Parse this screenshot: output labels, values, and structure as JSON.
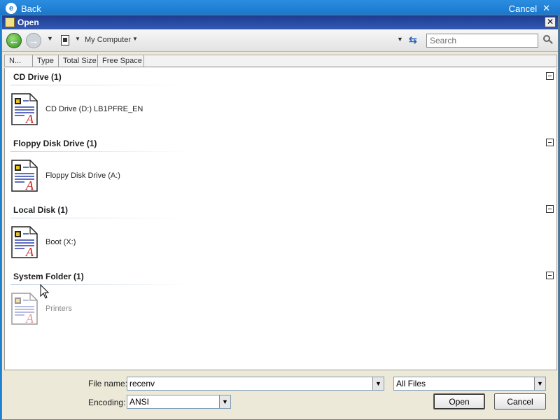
{
  "background": {
    "back_label": "Back",
    "cancel_label": "Cancel"
  },
  "dialog": {
    "title": "Open",
    "close_symbol": "✕"
  },
  "toolbar": {
    "location": "My Computer",
    "search_placeholder": "Search"
  },
  "columns": [
    "N...",
    "Type",
    "Total Size",
    "Free Space"
  ],
  "groups": [
    {
      "header": "CD Drive (1)",
      "item": "CD Drive (D:) LB1PFRE_EN",
      "dim": false
    },
    {
      "header": "Floppy Disk Drive (1)",
      "item": "Floppy Disk Drive (A:)",
      "dim": false
    },
    {
      "header": "Local Disk (1)",
      "item": "Boot (X:)",
      "dim": false
    },
    {
      "header": "System Folder (1)",
      "item": "Printers",
      "dim": true
    }
  ],
  "bottom": {
    "file_name_label": "File name:",
    "file_name_value": "recenv",
    "file_type_value": "All Files",
    "encoding_label": "Encoding:",
    "encoding_value": "ANSI",
    "open_label": "Open",
    "cancel_label": "Cancel"
  },
  "icons": {
    "back": "back-arrow-icon",
    "forward": "forward-arrow-icon",
    "search": "search-icon",
    "refresh": "refresh-icon",
    "file": "wordpad-document-icon"
  },
  "colors": {
    "title_bar": "#1e3c8e",
    "background": "#1f7fd0",
    "dialog": "#ece9d8"
  }
}
